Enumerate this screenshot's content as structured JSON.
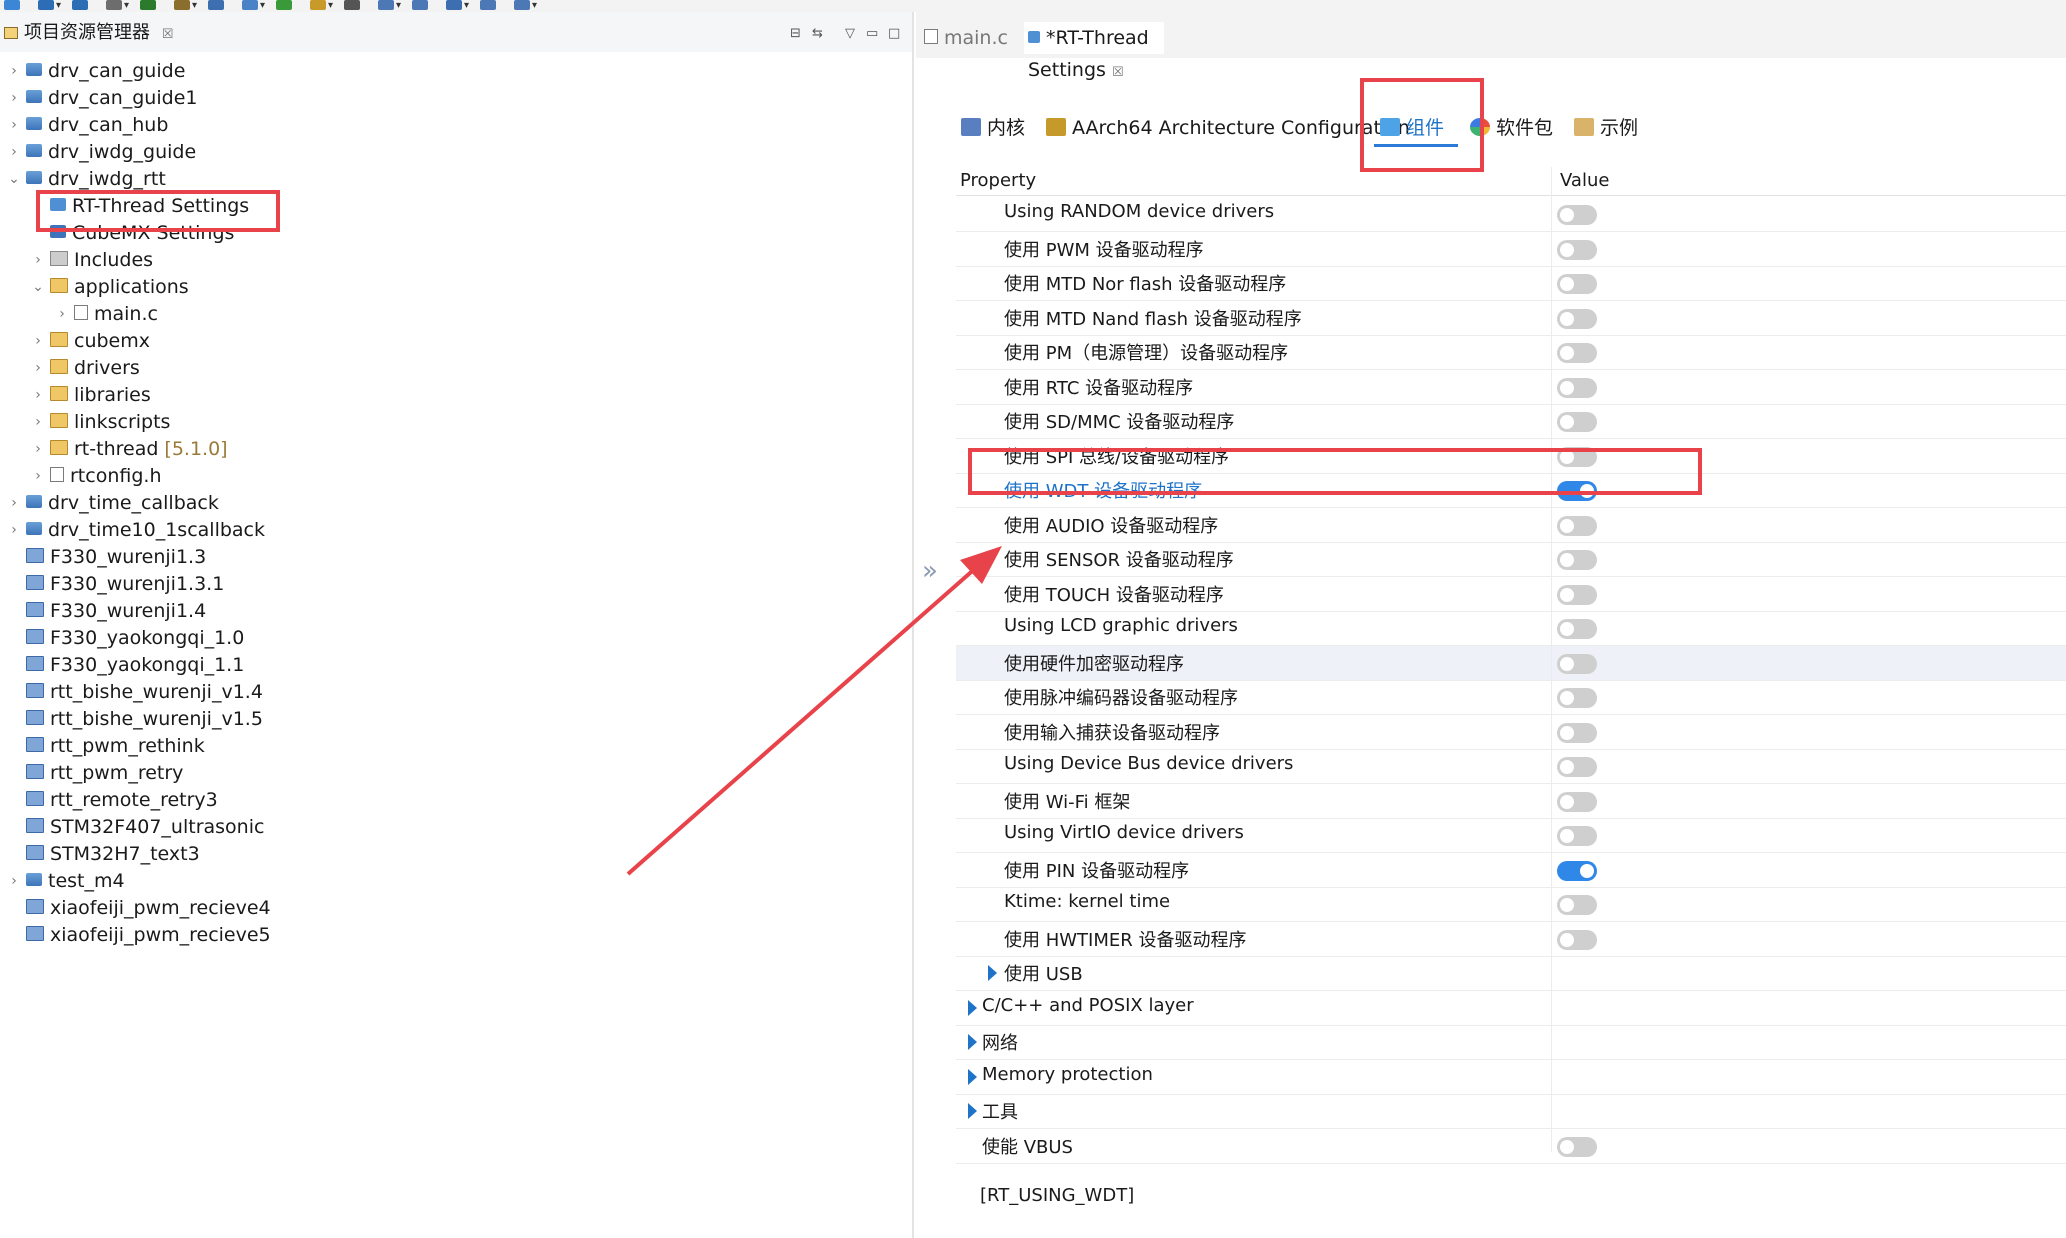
{
  "toolbar": {
    "icons": [
      "new-icon",
      "save-icon",
      "save-all-icon",
      "build-icon",
      "debug-icon",
      "download-icon",
      "monitor-icon",
      "settings-icon",
      "bug-icon",
      "open-icon",
      "search-icon",
      "sync-icon",
      "terminal-icon",
      "layers-icon",
      "back-icon",
      "forward-icon"
    ]
  },
  "explorer": {
    "title": "项目资源管理器",
    "close": "☒",
    "items": [
      {
        "label": "drv_can_guide",
        "type": "rtt",
        "expandable": true
      },
      {
        "label": "drv_can_guide1",
        "type": "rtt",
        "expandable": true
      },
      {
        "label": "drv_can_hub",
        "type": "rtt",
        "expandable": true
      },
      {
        "label": "drv_iwdg_guide",
        "type": "rtt",
        "expandable": true
      },
      {
        "label": "drv_iwdg_rtt",
        "type": "rtt",
        "expandable": true,
        "expanded": true
      },
      {
        "label": "RT-Thread Settings",
        "type": "settings"
      },
      {
        "label": "CubeMX Settings",
        "type": "cube"
      },
      {
        "label": "Includes",
        "type": "includes",
        "expandable": true
      },
      {
        "label": "applications",
        "type": "folder",
        "expandable": true,
        "expanded": true
      },
      {
        "label": "main.c",
        "type": "file",
        "expandable": true
      },
      {
        "label": "cubemx",
        "type": "folder",
        "expandable": true
      },
      {
        "label": "drivers",
        "type": "folder",
        "expandable": true
      },
      {
        "label": "libraries",
        "type": "folder",
        "expandable": true
      },
      {
        "label": "linkscripts",
        "type": "folder",
        "expandable": true
      },
      {
        "label": "rt-thread",
        "version": "[5.1.0]",
        "type": "folder",
        "expandable": true
      },
      {
        "label": "rtconfig.h",
        "type": "file",
        "expandable": true
      },
      {
        "label": "drv_time_callback",
        "type": "rtt",
        "expandable": true
      },
      {
        "label": "drv_time10_1scallback",
        "type": "rtt",
        "expandable": true
      },
      {
        "label": "F330_wurenji1.3",
        "type": "closed"
      },
      {
        "label": "F330_wurenji1.3.1",
        "type": "closed"
      },
      {
        "label": "F330_wurenji1.4",
        "type": "closed"
      },
      {
        "label": "F330_yaokongqi_1.0",
        "type": "closed"
      },
      {
        "label": "F330_yaokongqi_1.1",
        "type": "closed"
      },
      {
        "label": "rtt_bishe_wurenji_v1.4",
        "type": "closed"
      },
      {
        "label": "rtt_bishe_wurenji_v1.5",
        "type": "closed"
      },
      {
        "label": "rtt_pwm_rethink",
        "type": "closed"
      },
      {
        "label": "rtt_pwm_retry",
        "type": "closed"
      },
      {
        "label": "rtt_remote_retry3",
        "type": "closed"
      },
      {
        "label": "STM32F407_ultrasonic",
        "type": "closed"
      },
      {
        "label": "STM32H7_text3",
        "type": "closed"
      },
      {
        "label": "test_m4",
        "type": "rtt",
        "expandable": true
      },
      {
        "label": "xiaofeiji_pwm_recieve4",
        "type": "closed"
      },
      {
        "label": "xiaofeiji_pwm_recieve5",
        "type": "closed"
      }
    ]
  },
  "editor": {
    "tabs": [
      {
        "label": "main.c"
      },
      {
        "label": "*RT-Thread Settings",
        "close": "☒"
      }
    ],
    "settings_tabs": [
      "内核",
      "AArch64 Architecture Configuration",
      "组件",
      "软件包",
      "示例"
    ],
    "table": {
      "col_property": "Property",
      "col_value": "Value",
      "rows": [
        {
          "label": "Using RANDOM device drivers",
          "toggle": false
        },
        {
          "label": "使用 PWM 设备驱动程序",
          "toggle": false
        },
        {
          "label": "使用 MTD Nor flash 设备驱动程序",
          "toggle": false
        },
        {
          "label": "使用 MTD Nand flash 设备驱动程序",
          "toggle": false
        },
        {
          "label": "使用 PM（电源管理）设备驱动程序",
          "toggle": false
        },
        {
          "label": "使用 RTC 设备驱动程序",
          "toggle": false
        },
        {
          "label": "使用 SD/MMC 设备驱动程序",
          "toggle": false
        },
        {
          "label": "使用 SPI 总线/设备驱动程序",
          "toggle": false
        },
        {
          "label": "使用 WDT 设备驱动程序",
          "toggle": true,
          "selected": true
        },
        {
          "label": "使用 AUDIO 设备驱动程序",
          "toggle": false
        },
        {
          "label": "使用 SENSOR 设备驱动程序",
          "toggle": false
        },
        {
          "label": "使用 TOUCH 设备驱动程序",
          "toggle": false
        },
        {
          "label": "Using LCD graphic drivers",
          "toggle": false
        },
        {
          "label": "使用硬件加密驱动程序",
          "toggle": false,
          "highlight": true
        },
        {
          "label": "使用脉冲编码器设备驱动程序",
          "toggle": false
        },
        {
          "label": "使用输入捕获设备驱动程序",
          "toggle": false
        },
        {
          "label": "Using Device Bus device drivers",
          "toggle": false
        },
        {
          "label": "使用 Wi-Fi 框架",
          "toggle": false
        },
        {
          "label": "Using VirtIO device drivers",
          "toggle": false
        },
        {
          "label": "使用 PIN 设备驱动程序",
          "toggle": true
        },
        {
          "label": "Ktime: kernel time",
          "toggle": false
        },
        {
          "label": "使用 HWTIMER 设备驱动程序",
          "toggle": false
        },
        {
          "label": "使用 USB",
          "expander": true,
          "indent": 1
        },
        {
          "label": "C/C++ and POSIX layer",
          "expander": true,
          "indent": 0
        },
        {
          "label": "网络",
          "expander": true,
          "indent": 0
        },
        {
          "label": "Memory protection",
          "expander": true,
          "indent": 0
        },
        {
          "label": "工具",
          "expander": true,
          "indent": 0
        },
        {
          "label": "使能 VBUS",
          "toggle": false,
          "indent": 0
        }
      ]
    },
    "macro": "[RT_USING_WDT]"
  },
  "colors": {
    "accent": "#1e73c8",
    "toggle_on": "#2f88e8",
    "toggle_off": "#cfcfcf",
    "annotation": "#e8424a"
  }
}
